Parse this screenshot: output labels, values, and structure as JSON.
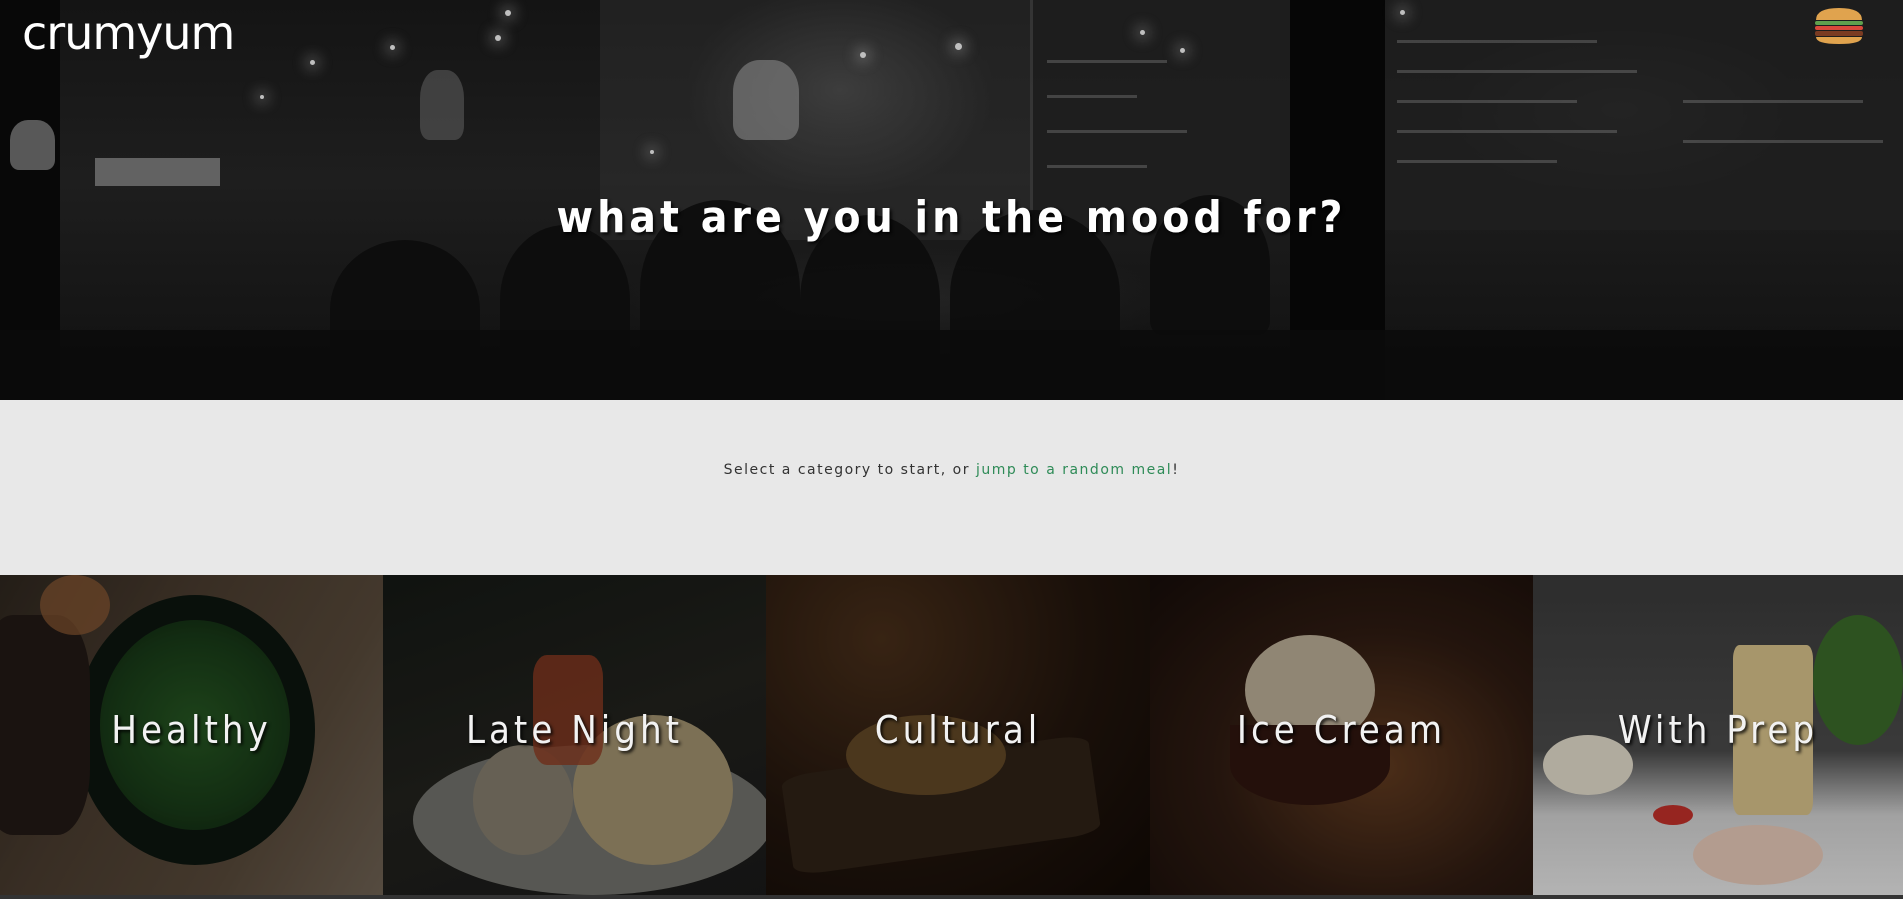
{
  "header": {
    "logo_text": "crumyum",
    "menu_icon": "hamburger-icon",
    "menu_colors": {
      "bun": "#e0a34e",
      "lettuce": "#5fa04e",
      "patty": "#7a3b22",
      "tomato": "#d9483b"
    }
  },
  "hero": {
    "title": "what are you in the mood for?"
  },
  "intro": {
    "text_before": "Select a category to start, or ",
    "link_text": "jump to a random meal",
    "text_after": "!",
    "link_color": "#2e8b57"
  },
  "categories": [
    {
      "label": "Healthy"
    },
    {
      "label": "Late Night"
    },
    {
      "label": "Cultural"
    },
    {
      "label": "Ice Cream"
    },
    {
      "label": "With Prep"
    }
  ]
}
